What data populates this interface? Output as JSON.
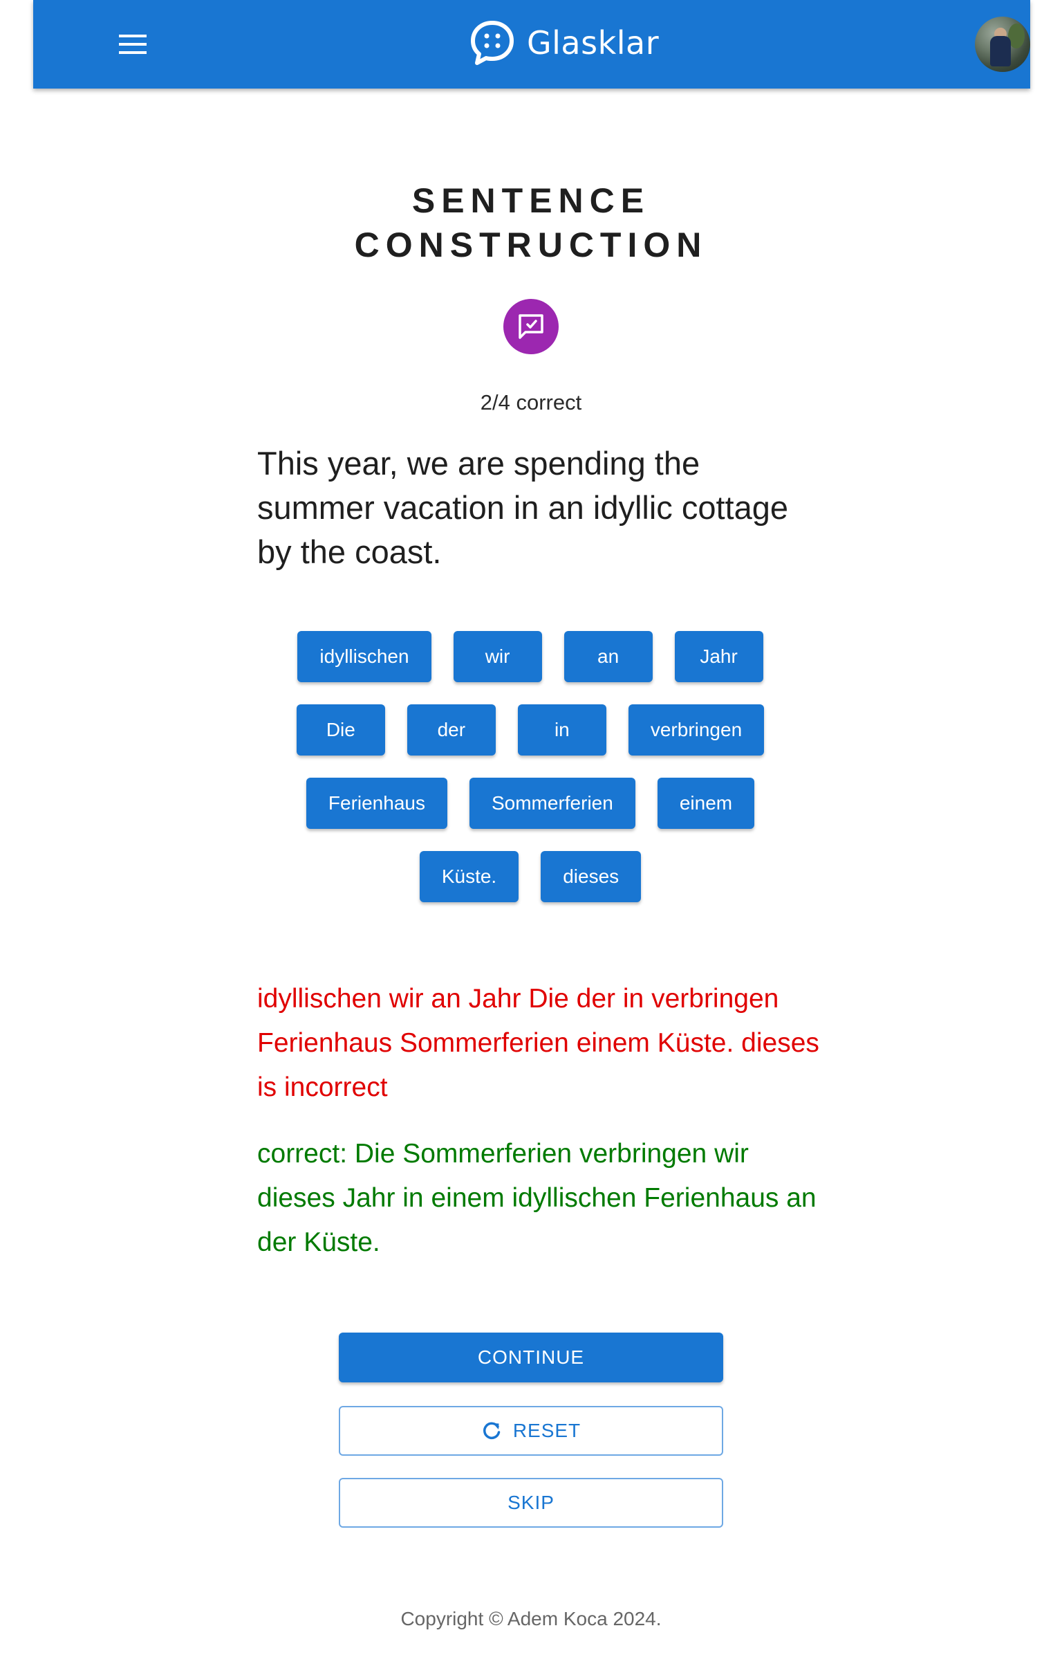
{
  "header": {
    "app_name": "Glasklar",
    "menu_icon": "hamburger-menu-icon",
    "logo_icon": "chat-bubble-icon",
    "avatar": "user-avatar",
    "color": "#1976d2"
  },
  "exercise": {
    "title_line1": "SENTENCE",
    "title_line2": "CONSTRUCTION",
    "badge_icon": "chat-check-icon",
    "badge_color": "#9c27b0",
    "score": "2/4 correct",
    "prompt": "This year, we are spending the summer vacation in an idyllic cottage by the coast."
  },
  "chips": {
    "rows": [
      [
        "idyllischen",
        "wir",
        "an",
        "Jahr"
      ],
      [
        "Die",
        "der",
        "in",
        "verbringen"
      ],
      [
        "Ferienhaus",
        "Sommerferien",
        "einem"
      ],
      [
        "Küste.",
        "dieses"
      ]
    ]
  },
  "result": {
    "incorrect": "idyllischen wir an Jahr Die der in verbringen Ferienhaus Sommerferien einem Küste. dieses is incorrect",
    "correct": "correct: Die Sommerferien verbringen wir dieses Jahr in einem idyllischen Ferienhaus an der Küste.",
    "incorrect_color": "#e00000",
    "correct_color": "#007a00"
  },
  "actions": {
    "continue_label": "CONTINUE",
    "reset_label": "RESET",
    "reset_icon": "refresh-icon",
    "skip_label": "SKIP"
  },
  "footer": {
    "copyright": "Copyright © Adem Koca 2024."
  }
}
